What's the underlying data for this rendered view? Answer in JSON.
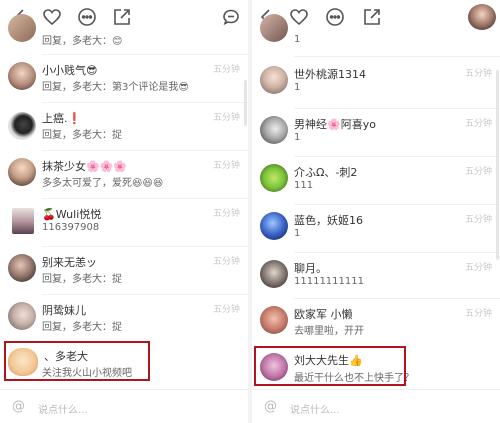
{
  "left": {
    "rows": [
      {
        "name": "",
        "message": "回复，多老大：😊",
        "time": ""
      },
      {
        "name": "小小贱气😎",
        "message": "回复，多老大：第3个评论是我😎",
        "time": "五分钟"
      },
      {
        "name": "上癌.❗",
        "message": "回复，多老大：捉",
        "time": "五分钟"
      },
      {
        "name": "抹茶少女🌸🌸🌸",
        "message": "多多太可爱了，爱死😆😆😆",
        "time": "五分钟"
      },
      {
        "name": "🍒Wuli悦悦",
        "message": "116397908",
        "time": "五分钟"
      },
      {
        "name": "别来无恙ッ",
        "message": "回复，多老大：捉",
        "time": "五分钟"
      },
      {
        "name": "阴鸷妹儿",
        "message": "回复，多老大：捉",
        "time": "五分钟"
      },
      {
        "name": "、多老大",
        "message": "关注我火山小视频吧",
        "time": ""
      }
    ],
    "input_placeholder": "说点什么..."
  },
  "right": {
    "rows": [
      {
        "name": "",
        "message": "1",
        "time": ""
      },
      {
        "name": "世外桃源1314",
        "message": "1",
        "time": "五分钟"
      },
      {
        "name": "男神经🌸阿喜yo",
        "message": "1",
        "time": "五分钟"
      },
      {
        "name": "介ふΩ、-刺2",
        "message": "111",
        "time": "五分钟"
      },
      {
        "name": "蓝色，妖姬16",
        "message": "1",
        "time": "五分钟"
      },
      {
        "name": "聊月。",
        "message": "11111111111",
        "time": "五分钟"
      },
      {
        "name": "欧家军  小懒",
        "message": "去哪里啦，开开",
        "time": "五分钟"
      },
      {
        "name": "刘大大先生👍",
        "message": "最近干什么也不上快手了？",
        "time": ""
      }
    ],
    "input_placeholder": "说点什么..."
  },
  "icons": {
    "back": "back-arrow-icon",
    "like": "heart-icon",
    "more": "more-dots-icon",
    "share": "share-icon",
    "comment": "comment-bubble-icon",
    "at": "at-icon"
  },
  "colors": {
    "highlight": "#b0141c",
    "time": "#c9c9c9"
  }
}
